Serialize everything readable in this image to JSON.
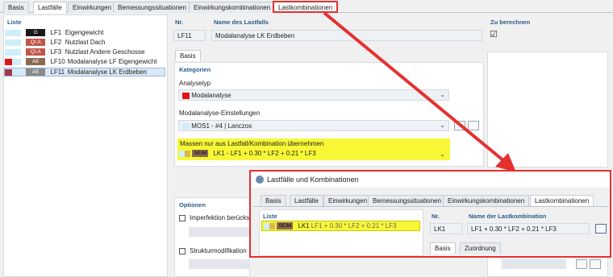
{
  "tabs": [
    "Basis",
    "Lastfälle",
    "Einwirkungen",
    "Bemessungssituationen",
    "Einwirkungskombinationen",
    "Lastkombinationen"
  ],
  "list": {
    "header": "Liste",
    "items": [
      {
        "color": "#cfeef8",
        "tag": "G",
        "tag_color": "#1a1a1a",
        "id": "LF1",
        "name": "Eigengewicht"
      },
      {
        "color": "#cfeef8",
        "tag": "QI A",
        "tag_color": "#c0564a",
        "id": "LF2",
        "name": "Nutzlast Dach"
      },
      {
        "color": "#cfeef8",
        "tag": "QI A",
        "tag_color": "#c0564a",
        "id": "LF3",
        "name": "Nutzlast Andere Geschosse"
      },
      {
        "color": "#e01515",
        "tag": "AE",
        "tag_color": "#8a6a50",
        "id": "LF10",
        "name": "Modalanalyse LF Eigengewicht"
      },
      {
        "color": "#a8354a",
        "tag": "AE",
        "tag_color": "#8a8a8a",
        "id": "LF11",
        "name": "Modalanalyse LK Erdbeben"
      }
    ]
  },
  "detail": {
    "nr_label": "Nr.",
    "nr_value": "LF11",
    "name_label": "Name des Lastfalls",
    "name_value": "Modalanalyse LK Erdbeben",
    "calc_label": "Zu berechnen",
    "calc_checked": "☑",
    "subtab": "Basis",
    "kategorien": "Kategorien",
    "analysetyp_label": "Analysetyp",
    "analysetyp_value": "Modalanalyse",
    "analysetyp_color": "#e01515",
    "modal_settings_label": "Modalanalyse-Einstellungen",
    "modal_settings_value": "MOS1 - #4 | Lanczos",
    "masses_label": "Massen nur aus Lastfall/Kombination  übernehmen",
    "masses_tag": "SE/M",
    "masses_value": "LK1 - LF1 + 0.30 * LF2 + 0.21 * LF3",
    "optionen": "Optionen",
    "imperfection": "Imperfektion berücksi",
    "struktur": "Strukturmodifikation"
  },
  "dialog": {
    "title": "Lastfälle und Kombinationen",
    "tabs": [
      "Basis",
      "Lastfälle",
      "Einwirkungen",
      "Bemessungssituationen",
      "Einwirkungskombinationen",
      "Lastkombinationen"
    ],
    "list_header": "Liste",
    "row_tag": "SE/M",
    "row_id": "LK1",
    "row_name": "LF1 + 0.30 * LF2 + 0.21 * LF3",
    "nr_label": "Nr.",
    "nr_value": "LK1",
    "name_label": "Name der Lastkombination",
    "name_value": "LF1 + 0.30 * LF2 + 0.21 * LF3",
    "subtabs": [
      "Basis",
      "Zuordnung"
    ]
  },
  "colors": {
    "highlight": "#e53030",
    "yellow": "#f7f736",
    "header_blue": "#2a5b8a"
  }
}
